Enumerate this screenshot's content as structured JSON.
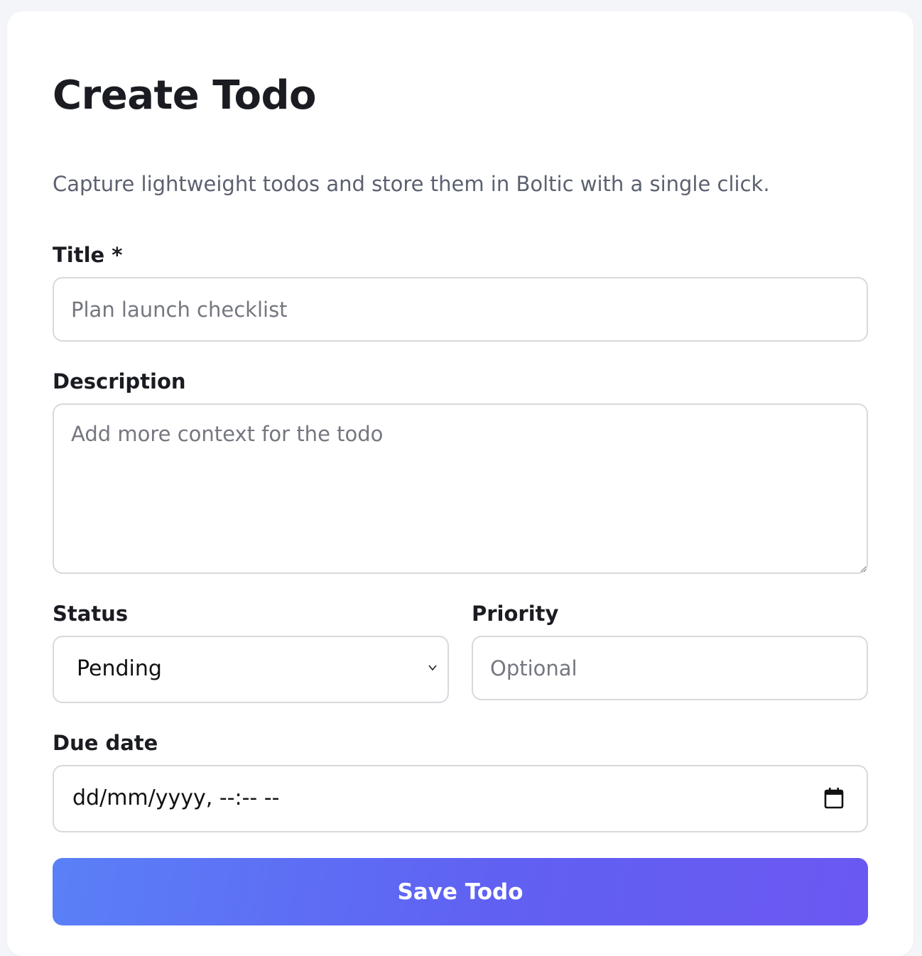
{
  "form": {
    "heading": "Create Todo",
    "subtitle": "Capture lightweight todos and store them in Boltic with a single click.",
    "title_label": "Title *",
    "title_placeholder": "Plan launch checklist",
    "description_label": "Description",
    "description_placeholder": "Add more context for the todo",
    "status_label": "Status",
    "status_value": "Pending",
    "priority_label": "Priority",
    "priority_placeholder": "Optional",
    "due_label": "Due date",
    "due_value": "dd/mm/yyyy, --:-- --",
    "save_label": "Save Todo"
  },
  "icons": {
    "status_dropdown": "chevron-down-icon",
    "due_picker": "calendar-icon",
    "textarea_resize": "resize-grip-icon"
  },
  "colors": {
    "button_gradient_start": "#5a80f7",
    "button_gradient_end": "#6b58f2",
    "card_background": "#ffffff",
    "page_background": "#f4f5f9"
  }
}
